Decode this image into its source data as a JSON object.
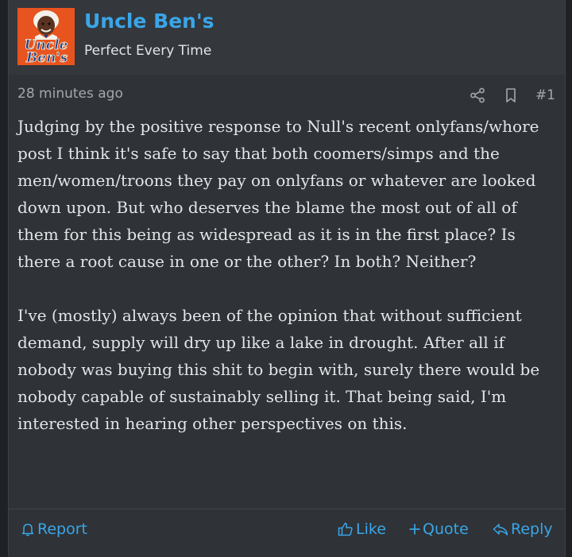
{
  "user": {
    "name": "Uncle Ben's",
    "title": "Perfect Every Time",
    "avatar_logo_text": [
      "Uncle",
      "Ben's"
    ]
  },
  "post": {
    "time": "28 minutes ago",
    "number": "#1",
    "paragraphs": [
      "Judging by the positive response to Null's recent onlyfans/whore post I think it's safe to say that both coomers/simps and the men/women/troons they pay on onlyfans or whatever are looked down upon. But who deserves the blame the most out of all of them for this being as widespread as it is in the first place? Is there a root cause in one or the other? In both? Neither?",
      "I've (mostly) always been of the opinion that without sufficient demand, supply will dry up like a lake in drought. After all if nobody was buying this shit to begin with, surely there would be nobody capable of sustainably selling it. That being said, I'm interested in hearing other perspectives on this."
    ]
  },
  "actions": {
    "report": "Report",
    "like": "Like",
    "quote": "Quote",
    "reply": "Reply"
  },
  "colors": {
    "accent": "#3aa6e8",
    "background": "#2f3236",
    "header": "#34373c",
    "text": "#e3e5e8",
    "muted": "#a4a8ae",
    "avatar_bg": "#e8541f"
  },
  "icons": {
    "share": "share-icon",
    "bookmark": "bookmark-icon",
    "report": "bell-icon",
    "like": "thumbs-up-icon",
    "quote": "plus-icon",
    "reply": "reply-arrow-icon"
  }
}
